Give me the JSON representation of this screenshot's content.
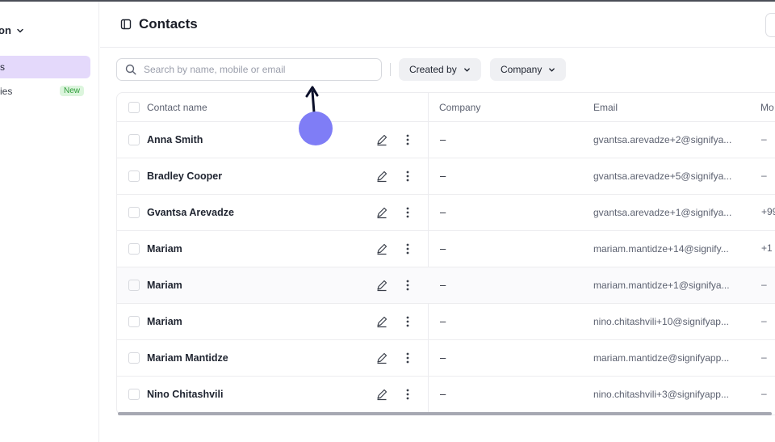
{
  "sidebar": {
    "org_label": "on",
    "items": [
      {
        "label": "s",
        "active": true
      },
      {
        "label": "ies",
        "badge": "New"
      }
    ]
  },
  "header": {
    "title": "Contacts"
  },
  "filters": {
    "search_placeholder": "Search by name, mobile or email",
    "created_by_label": "Created by",
    "company_label": "Company"
  },
  "table": {
    "columns": [
      "Contact name",
      "Company",
      "Email",
      "Mo"
    ],
    "rows": [
      {
        "name": "Anna Smith",
        "company": "–",
        "email": "gvantsa.arevadze+2@signifya...",
        "mobile": "–"
      },
      {
        "name": "Bradley Cooper",
        "company": "–",
        "email": "gvantsa.arevadze+5@signifya...",
        "mobile": "–"
      },
      {
        "name": "Gvantsa Arevadze",
        "company": "–",
        "email": "gvantsa.arevadze+1@signifya...",
        "mobile": "+99"
      },
      {
        "name": "Mariam",
        "company": "–",
        "email": "mariam.mantidze+14@signify...",
        "mobile": "+1"
      },
      {
        "name": "Mariam",
        "company": "–",
        "email": "mariam.mantidze+1@signifya...",
        "mobile": "–"
      },
      {
        "name": "Mariam",
        "company": "–",
        "email": "nino.chitashvili+10@signifyap...",
        "mobile": "–"
      },
      {
        "name": "Mariam Mantidze",
        "company": "–",
        "email": "mariam.mantidze@signifyapp...",
        "mobile": "–"
      },
      {
        "name": "Nino Chitashvili",
        "company": "–",
        "email": "nino.chitashvili+3@signifyapp...",
        "mobile": "–"
      }
    ]
  },
  "colors": {
    "accent": "#e4d9fb",
    "cursor": "#7f7df6",
    "badge_bg": "#dcf5dd",
    "badge_text": "#2f9d3a"
  },
  "icons": [
    "chevron-down-icon",
    "sidebar-panel-icon",
    "search-icon",
    "edit-pen-icon",
    "more-vertical-icon"
  ]
}
